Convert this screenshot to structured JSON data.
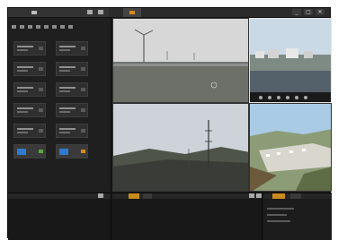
{
  "window": {
    "controls": [
      "_",
      "▢",
      "✕"
    ]
  },
  "tabs": {
    "live_active": true
  },
  "devices": {
    "cells": [
      {
        "status": "offline"
      },
      {
        "status": "offline"
      },
      {
        "status": "offline"
      },
      {
        "status": "offline"
      },
      {
        "status": "offline"
      },
      {
        "status": "offline"
      },
      {
        "status": "offline"
      },
      {
        "status": "offline"
      },
      {
        "status": "offline"
      },
      {
        "status": "offline"
      },
      {
        "status": "online",
        "color": "#2e7bcf"
      },
      {
        "status": "online",
        "color": "#2e7bcf"
      }
    ]
  },
  "cameras": [
    {
      "caption": "...",
      "scene": "sea-turbine"
    },
    {
      "caption": "",
      "scene": "coastal-buildings"
    },
    {
      "caption": "...",
      "scene": "hilltop-mast"
    },
    {
      "caption": "...",
      "scene": "valley-town"
    }
  ],
  "colors": {
    "accent": "#d98a1a",
    "background": "#1b1b1b"
  }
}
